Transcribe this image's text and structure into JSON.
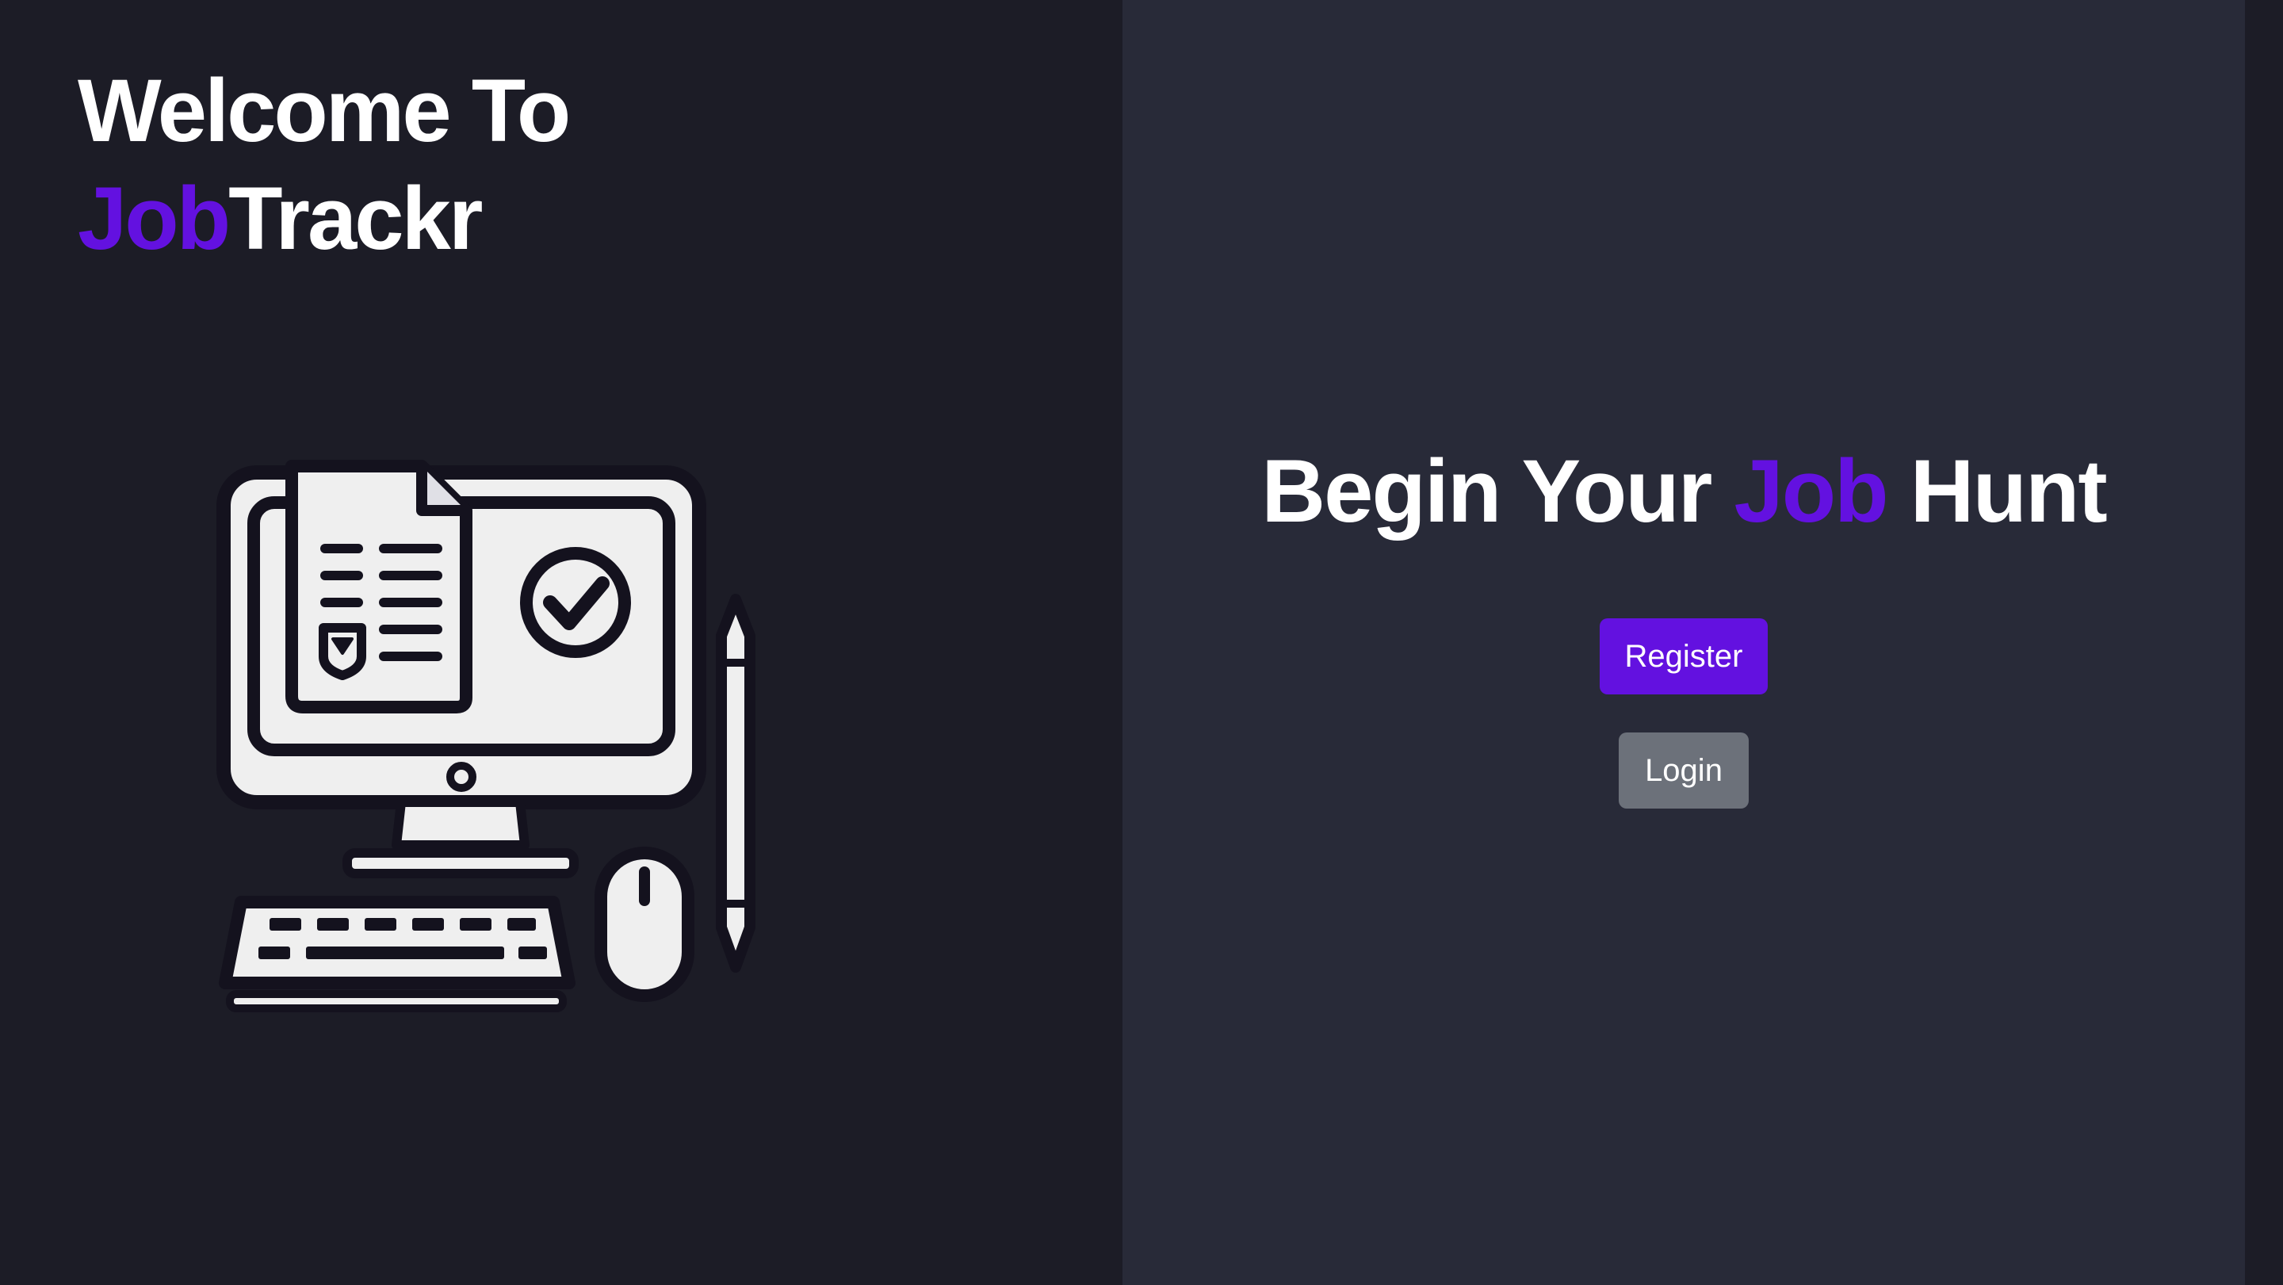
{
  "welcome": {
    "line1": "Welcome To",
    "brand_accent": "Job",
    "brand_rest": "Trackr"
  },
  "hero": {
    "title_start": "Begin Your ",
    "title_accent": "Job",
    "title_end": " Hunt"
  },
  "buttons": {
    "register": "Register",
    "login": "Login"
  },
  "illustration": {
    "icon": "computer-with-document-and-checkmark-icon"
  },
  "colors": {
    "left_bg": "#1c1c26",
    "right_bg": "#282a38",
    "accent": "#6311e0",
    "login_button": "#6c717a",
    "text": "#ffffff"
  }
}
